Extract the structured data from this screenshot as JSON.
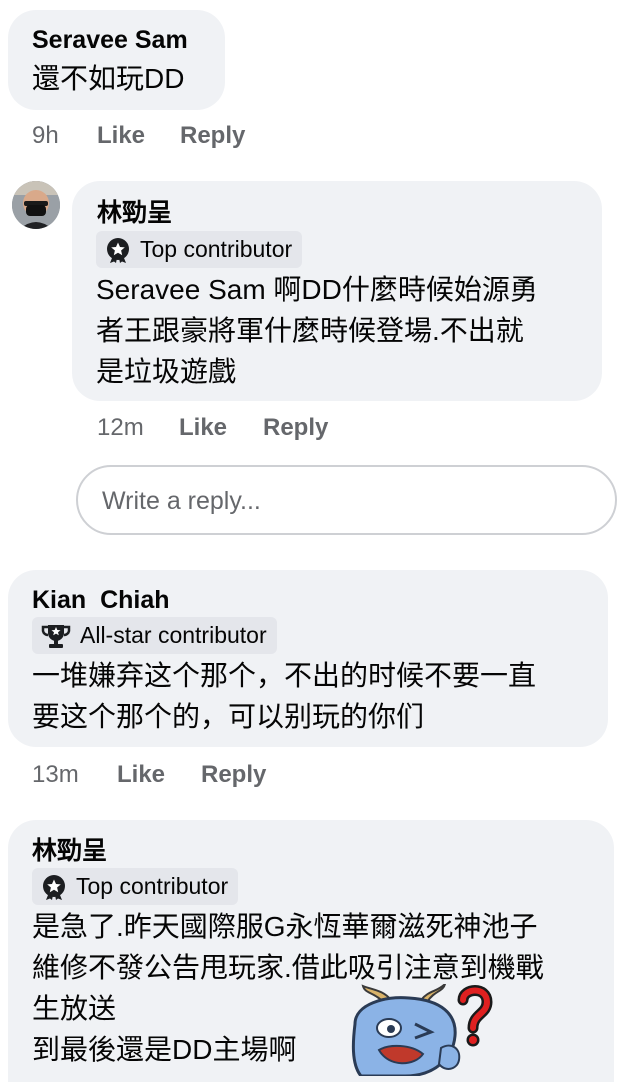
{
  "comments": [
    {
      "author": "Seravee Sam",
      "text": "還不如玩DD",
      "time": "9h",
      "like": "Like",
      "reply": "Reply"
    },
    {
      "author": "林勁呈",
      "badge": "Top contributor",
      "badge_icon": "top-contributor-icon",
      "lines": [
        "Seravee Sam 啊DD什麼時候始源勇",
        "者王跟豪將軍什麼時候登場.不出就",
        "是垃圾遊戲"
      ],
      "time": "12m",
      "like": "Like",
      "reply": "Reply"
    },
    {
      "author": "Kian  Chiah",
      "badge": "All-star contributor",
      "badge_icon": "trophy-icon",
      "lines": [
        "一堆嫌弃这个那个，不出的时候不要一直",
        "要这个那个的，可以别玩的你们"
      ],
      "time": "13m",
      "like": "Like",
      "reply": "Reply"
    },
    {
      "author": "林勁呈",
      "badge": "Top contributor",
      "badge_icon": "top-contributor-icon",
      "lines": [
        "是急了.昨天國際服G永恆華爾滋死神池子",
        "維修不發公告甩玩家.借此吸引注意到機戰",
        "生放送",
        "到最後還是DD主場啊"
      ],
      "sticker": "confused-dragon-sticker"
    }
  ],
  "reply_box": {
    "placeholder": "Write a reply..."
  }
}
